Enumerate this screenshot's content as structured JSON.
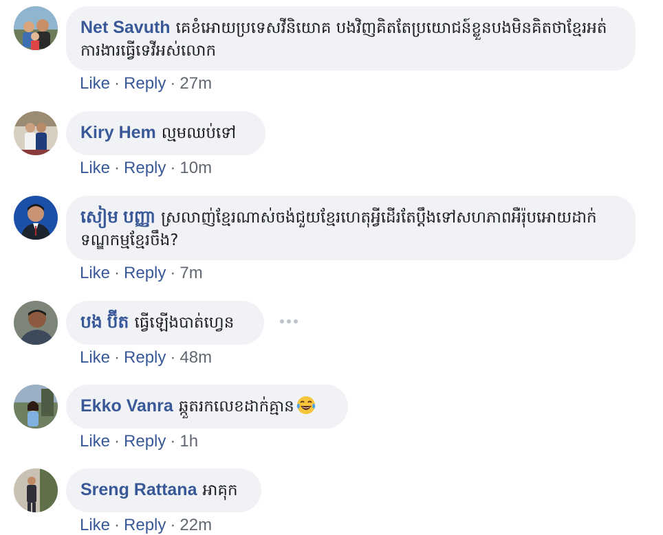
{
  "comments": [
    {
      "author": "Net Savuth",
      "text": "គេខំអោយប្រទេសវីនិយោគ បងវិញគិតតែប្រយោជន៍ខ្លួនបងមិនគិតថាខ្មែរអត់ការងារធ្វើទេវីអស់លោក",
      "like": "Like",
      "reply": "Reply",
      "time": "27m"
    },
    {
      "author": "Kiry Hem",
      "text": "ល្មមឈប់ទៅ",
      "like": "Like",
      "reply": "Reply",
      "time": "10m"
    },
    {
      "author": "សៀម បញ្ញា",
      "text": "ស្រលាញ់ខ្មែរណាស់ចង់ជួយខ្មែរហេតុអ្វីដើរតែប្ដឹងទៅសហភាពអឺរ៉ុបអោយដាក់ទណ្ឌកម្មខ្មែរចឹង?",
      "like": "Like",
      "reply": "Reply",
      "time": "7m"
    },
    {
      "author": "បង ប៊ីត",
      "text": "ធ្វើឡើងបាត់ហ្វេន",
      "like": "Like",
      "reply": "Reply",
      "time": "48m"
    },
    {
      "author": "Ekko Vanra",
      "text": "ឆ្កួតរកលេខដាក់គ្មាន",
      "emoji": "laughing-tears-emoji",
      "like": "Like",
      "reply": "Reply",
      "time": "1h"
    },
    {
      "author": "Sreng Rattana",
      "text": "អាគុក",
      "like": "Like",
      "reply": "Reply",
      "time": "22m"
    }
  ],
  "icons": {
    "more": "more-options-icon"
  },
  "colors": {
    "author": "#385898",
    "bubble": "#f0f2f5",
    "meta": "#606770"
  }
}
